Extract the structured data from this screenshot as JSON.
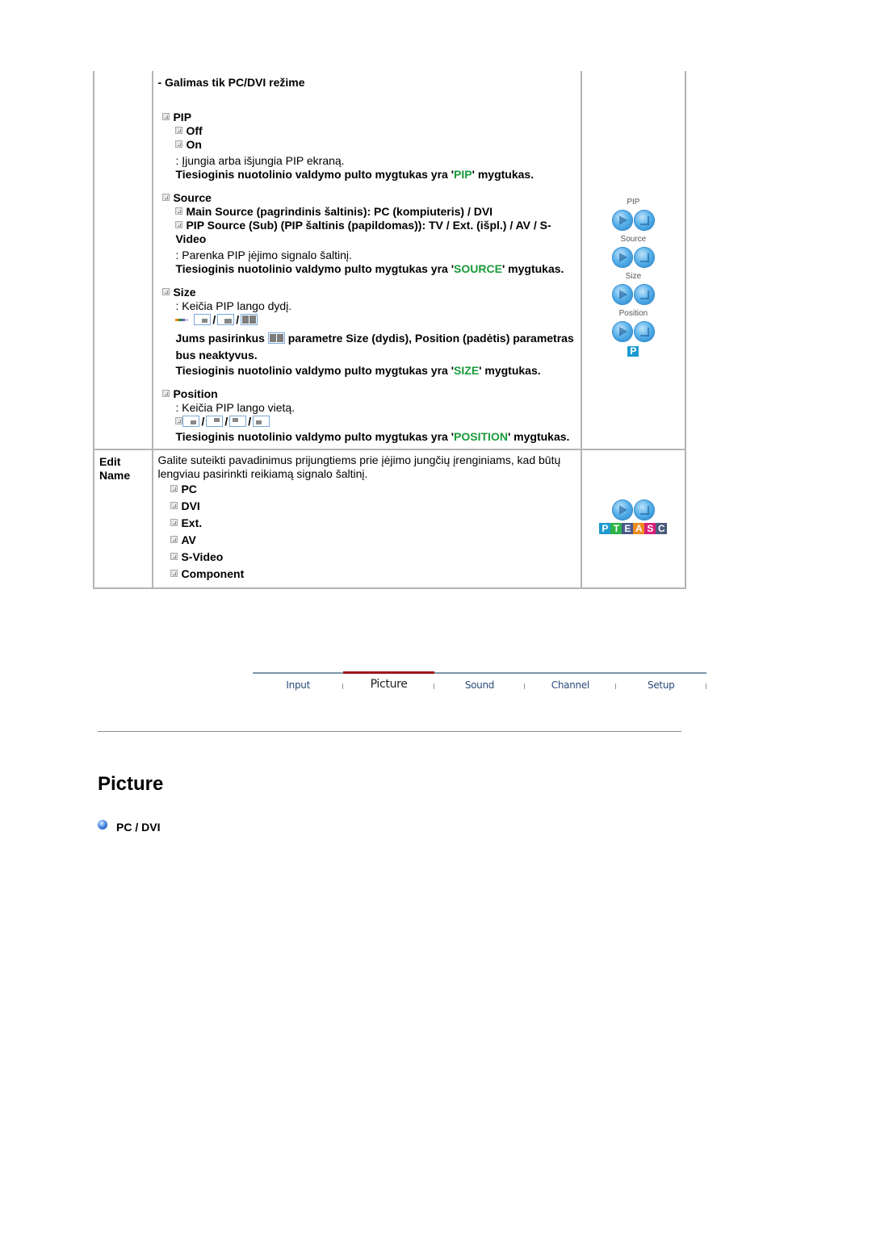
{
  "pip_row": {
    "note": "- Galimas tik PC/DVI režime",
    "pip": {
      "title": "PIP",
      "options": [
        "Off",
        "On"
      ],
      "desc": ": Įjungia arba išjungia PIP ekraną.",
      "remote_pre": "Tiesioginis nuotolinio valdymo pulto mygtukas yra '",
      "remote_key": "PIP",
      "remote_post": "' mygtukas."
    },
    "source": {
      "title": "Source",
      "main": "Main Source (pagrindinis šaltinis): PC (kompiuteris) / DVI",
      "pip_source": "PIP Source (Sub) (PIP šaltinis (papildomas)): TV / Ext. (išpl.) / AV / S-Video",
      "desc": ": Parenka PIP įėjimo signalo šaltinį.",
      "remote_pre": "Tiesioginis nuotolinio valdymo pulto mygtukas yra '",
      "remote_key": "SOURCE",
      "remote_post": "' mygtukas."
    },
    "size": {
      "title": "Size",
      "desc": ": Keičia PIP lango dydį.",
      "slash": "/",
      "note_pre": "Jums pasirinkus",
      "note_post": "parametre Size (dydis), Position (padėtis) parametras bus neaktyvus.",
      "remote_pre": "Tiesioginis nuotolinio valdymo pulto mygtukas yra '",
      "remote_key": "SIZE",
      "remote_post": "' mygtukas."
    },
    "position": {
      "title": "Position",
      "desc": ": Keičia PIP lango vietą.",
      "slash": "/",
      "remote_pre": "Tiesioginis nuotolinio valdymo pulto mygtukas yra '",
      "remote_key": "POSITION",
      "remote_post": "' mygtukas."
    },
    "icons": {
      "labels": [
        "PIP",
        "Source",
        "Size",
        "Position"
      ],
      "badge": "P"
    }
  },
  "edit_name_row": {
    "label": "Edit Name",
    "desc": "Galite suteikti pavadinimus prijungtiems prie įėjimo jungčių įrenginiams, kad būtų lengviau pasirinkti reikiamą signalo šaltinį.",
    "options": [
      "PC",
      "DVI",
      "Ext.",
      "AV",
      "S-Video",
      "Component"
    ],
    "badge_letters": [
      {
        "letter": "P",
        "color": "#1e9ad0"
      },
      {
        "letter": "T",
        "color": "#2db34a"
      },
      {
        "letter": "E",
        "color": "#4a5a8a"
      },
      {
        "letter": "A",
        "color": "#f08a1c"
      },
      {
        "letter": "S",
        "color": "#d8207a"
      },
      {
        "letter": "C",
        "color": "#4a5a7a"
      }
    ]
  },
  "nav": {
    "tabs": [
      {
        "label": "Input",
        "active": false
      },
      {
        "label": "Picture",
        "active": true
      },
      {
        "label": "Sound",
        "active": false
      },
      {
        "label": "Channel",
        "active": false
      },
      {
        "label": "Setup",
        "active": false
      }
    ],
    "active_color": "#a0161a"
  },
  "section": {
    "title": "Picture",
    "subsection": "PC / DVI"
  },
  "colors": {
    "highlight_green": "#1a9a3a",
    "border": "#b4b4b4"
  }
}
